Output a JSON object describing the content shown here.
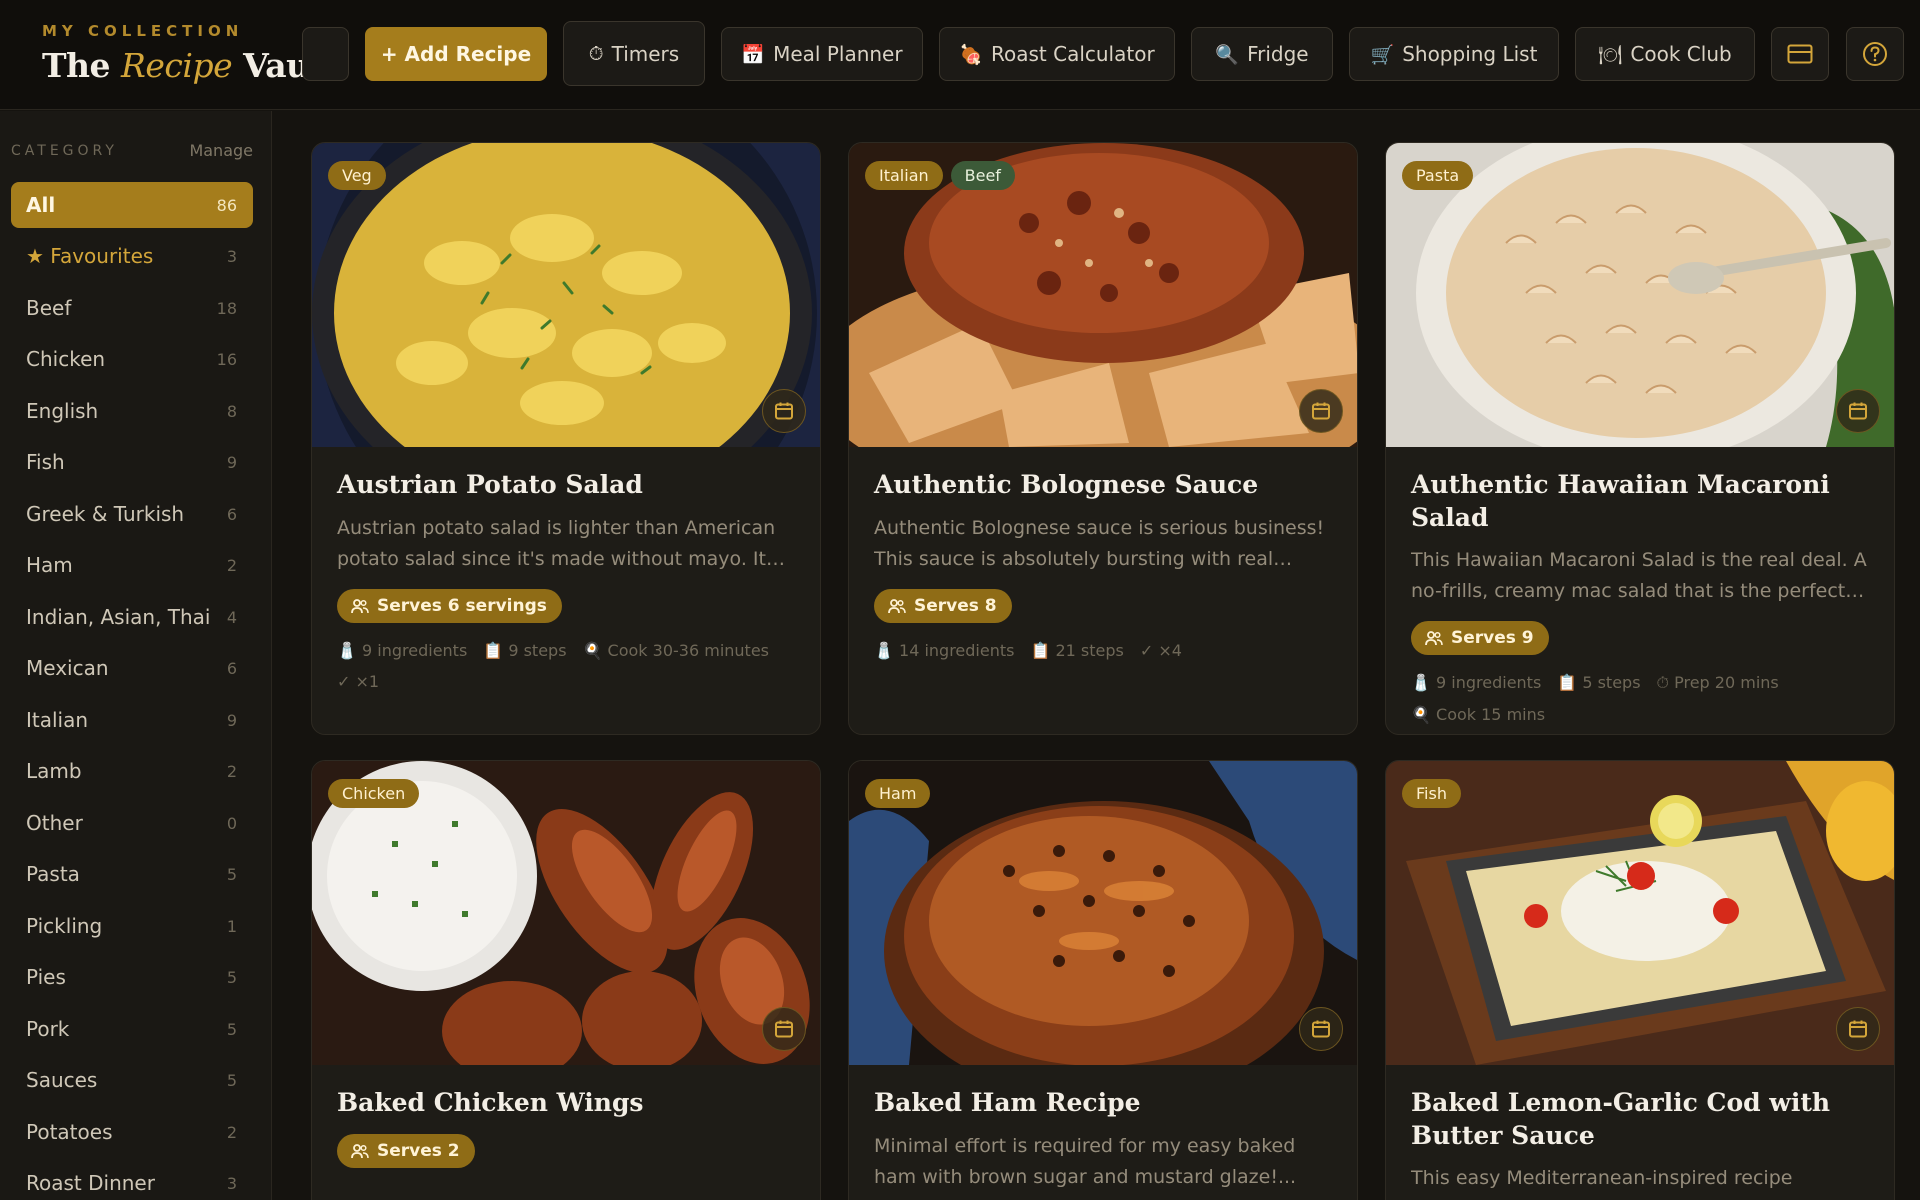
{
  "brand": {
    "kicker": "MY COLLECTION",
    "title_pre": "The ",
    "title_accent": "Recipe",
    "title_post": " Vault"
  },
  "header": {
    "add_recipe": "+ Add Recipe",
    "timers": "Timers",
    "meal_planner": "Meal Planner",
    "roast_calculator": "Roast Calculator",
    "fridge": "Fridge",
    "shopping_list": "Shopping List",
    "cook_club": "Cook Club"
  },
  "sidebar": {
    "category_label": "CATEGORY",
    "manage": "Manage",
    "items": [
      {
        "label": "All",
        "count": "86"
      },
      {
        "label": "★ Favourites",
        "count": "3"
      },
      {
        "label": "Beef",
        "count": "18"
      },
      {
        "label": "Chicken",
        "count": "16"
      },
      {
        "label": "English",
        "count": "8"
      },
      {
        "label": "Fish",
        "count": "9"
      },
      {
        "label": "Greek & Turkish",
        "count": "6"
      },
      {
        "label": "Ham",
        "count": "2"
      },
      {
        "label": "Indian, Asian, Thai",
        "count": "4"
      },
      {
        "label": "Mexican",
        "count": "6"
      },
      {
        "label": "Italian",
        "count": "9"
      },
      {
        "label": "Lamb",
        "count": "2"
      },
      {
        "label": "Other",
        "count": "0"
      },
      {
        "label": "Pasta",
        "count": "5"
      },
      {
        "label": "Pickling",
        "count": "1"
      },
      {
        "label": "Pies",
        "count": "5"
      },
      {
        "label": "Pork",
        "count": "5"
      },
      {
        "label": "Sauces",
        "count": "5"
      },
      {
        "label": "Potatoes",
        "count": "2"
      },
      {
        "label": "Roast Dinner",
        "count": "3"
      }
    ]
  },
  "cards": [
    {
      "tags": [
        "Veg"
      ],
      "title": "Austrian Potato Salad",
      "desc": "Austrian potato salad is lighter than American potato salad since it's made without mayo. It has a tangy vinegar dressing.",
      "serves": "Serves 6 servings",
      "meta": [
        "9 ingredients",
        "9 steps",
        "Cook 30-36 minutes",
        "✓ ×1"
      ]
    },
    {
      "tags": [
        "Italian",
        "Beef"
      ],
      "title": "Authentic Bolognese Sauce",
      "desc": "Authentic Bolognese sauce is serious business! This sauce is absolutely bursting with real tomato flavour.",
      "serves": "Serves 8",
      "meta": [
        "14 ingredients",
        "21 steps",
        "✓ ×4"
      ]
    },
    {
      "tags": [
        "Pasta"
      ],
      "title": "Authentic Hawaiian Macaroni Salad",
      "desc": "This Hawaiian Macaroni Salad is the real deal. A no-frills, creamy mac salad that is the perfect side dish.",
      "serves": "Serves 9",
      "meta": [
        "9 ingredients",
        "5 steps",
        "Prep 20 mins",
        "Cook 15 mins"
      ]
    },
    {
      "tags": [
        "Chicken"
      ],
      "title": "Baked Chicken Wings",
      "desc": "",
      "serves": "Serves 2",
      "meta": []
    },
    {
      "tags": [
        "Ham"
      ],
      "title": "Baked Ham Recipe",
      "desc": "Minimal effort is required for my easy baked ham with brown sugar and mustard glaze!...",
      "serves": "",
      "meta": []
    },
    {
      "tags": [
        "Fish"
      ],
      "title": "Baked Lemon-Garlic Cod with Butter Sauce",
      "desc": "This easy Mediterranean-inspired recipe features",
      "serves": "",
      "meta": []
    }
  ]
}
